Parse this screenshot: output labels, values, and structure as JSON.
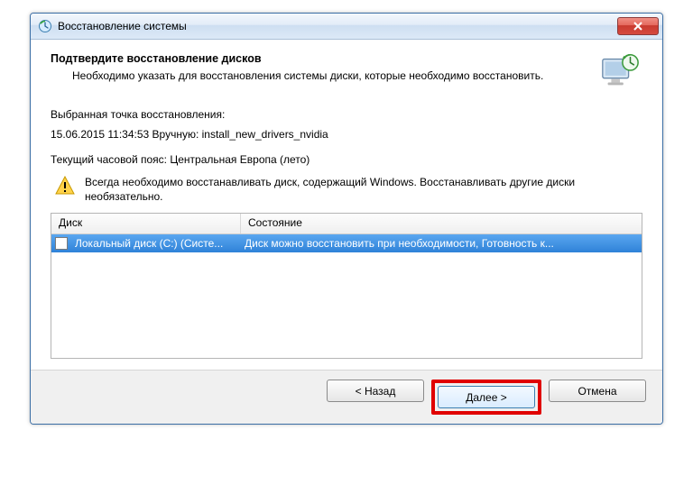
{
  "window": {
    "title": "Восстановление системы"
  },
  "header": {
    "title": "Подтвердите восстановление дисков",
    "description": "Необходимо указать для восстановления системы диски, которые необходимо восстановить."
  },
  "restorepoint": {
    "label": "Выбранная точка восстановления:",
    "value": "15.06.2015 11:34:53 Вручную: install_new_drivers_nvidia"
  },
  "timezone": {
    "text": "Текущий часовой пояс: Центральная Европа (лето)"
  },
  "warning": {
    "text": "Всегда необходимо восстанавливать диск, содержащий Windows. Восстанавливать другие диски необязательно."
  },
  "grid": {
    "columns": {
      "disk": "Диск",
      "status": "Состояние"
    },
    "rows": [
      {
        "disk": "Локальный диск (C:) (Систе...",
        "status": "Диск можно восстановить при необходимости, Готовность к..."
      }
    ]
  },
  "buttons": {
    "back": "< Назад",
    "next": "Далее >",
    "cancel": "Отмена"
  }
}
